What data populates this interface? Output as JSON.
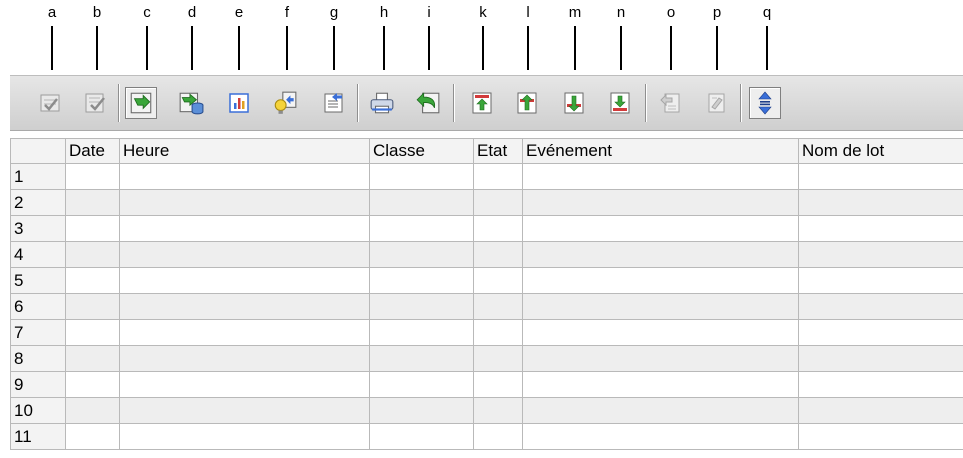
{
  "callouts": [
    "a",
    "b",
    "c",
    "d",
    "e",
    "f",
    "g",
    "h",
    "i",
    "k",
    "l",
    "m",
    "n",
    "o",
    "p",
    "q"
  ],
  "toolbar": {
    "buttons": [
      {
        "icon": "check-list-disabled-icon",
        "enabled": false
      },
      {
        "icon": "check-list-alt-disabled-icon",
        "enabled": false
      },
      {
        "icon": "refresh-arrow-icon",
        "enabled": true,
        "pressed": true
      },
      {
        "icon": "refresh-database-icon",
        "enabled": true
      },
      {
        "icon": "bar-chart-icon",
        "enabled": true
      },
      {
        "icon": "lightbulb-export-icon",
        "enabled": true
      },
      {
        "icon": "document-export-icon",
        "enabled": true
      },
      {
        "icon": "printer-icon",
        "enabled": true
      },
      {
        "icon": "undo-document-icon",
        "enabled": true
      },
      {
        "icon": "go-first-icon",
        "enabled": true
      },
      {
        "icon": "go-previous-icon",
        "enabled": true
      },
      {
        "icon": "go-next-icon",
        "enabled": true
      },
      {
        "icon": "go-last-icon",
        "enabled": true
      },
      {
        "icon": "move-up-disabled-icon",
        "enabled": false
      },
      {
        "icon": "move-down-disabled-icon",
        "enabled": false
      },
      {
        "icon": "expand-collapse-icon",
        "enabled": true,
        "pressed": true
      }
    ]
  },
  "table": {
    "columns": [
      "Date",
      "Heure",
      "Classe",
      "Etat",
      "Evénement",
      "Nom de lot"
    ],
    "rows": [
      "1",
      "2",
      "3",
      "4",
      "5",
      "6",
      "7",
      "8",
      "9",
      "10",
      "11"
    ]
  },
  "colors": {
    "accent_green": "#3aa63a",
    "accent_red": "#d23b3b",
    "accent_blue": "#3a6fd8",
    "toolbar_bg": "#dcdcdc",
    "row_alt": "#eeeeee"
  }
}
